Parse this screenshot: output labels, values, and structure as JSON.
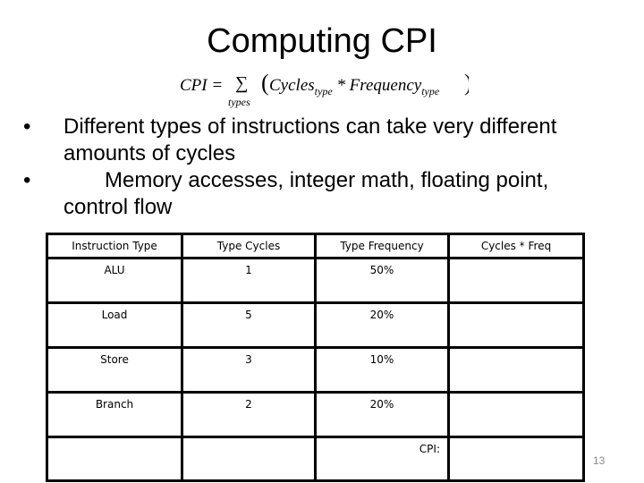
{
  "slide": {
    "title": "Computing CPI",
    "page_number": "13"
  },
  "formula": {
    "lhs": "CPI =",
    "sigma": "∑",
    "sigma_subscript": "types",
    "open_paren": "(",
    "cycles": "Cycles",
    "cycles_sub": "type",
    "operator": " * ",
    "frequency": "Frequency",
    "frequency_sub": "type",
    "close_paren": ")"
  },
  "bullets": [
    {
      "marker": "•",
      "text": "Different types of instructions can take very different amounts of cycles"
    },
    {
      "marker": "•",
      "text": "Memory accesses, integer math, floating point, control flow"
    }
  ],
  "table": {
    "headers": [
      "Instruction Type",
      "Type Cycles",
      "Type Frequency",
      "Cycles * Freq"
    ],
    "rows": [
      {
        "type": "ALU",
        "cycles": "1",
        "frequency": "50%",
        "product": ""
      },
      {
        "type": "Load",
        "cycles": "5",
        "frequency": "20%",
        "product": ""
      },
      {
        "type": "Store",
        "cycles": "3",
        "frequency": "10%",
        "product": ""
      },
      {
        "type": "Branch",
        "cycles": "2",
        "frequency": "20%",
        "product": ""
      }
    ],
    "total_label": "CPI:",
    "total_value": ""
  }
}
